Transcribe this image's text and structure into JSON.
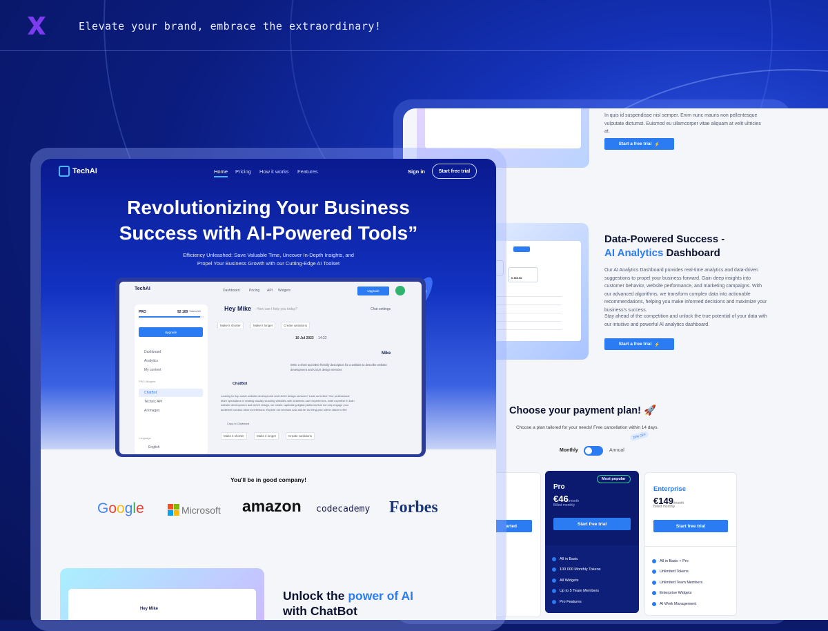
{
  "header": {
    "tagline": "Elevate your brand, embrace the extraordinary!"
  },
  "colors": {
    "accent": "#2b7bf2",
    "brand_x": "#7b3cf0",
    "navy": "#0c1a6b"
  },
  "left": {
    "brand": "TechAI",
    "nav": [
      "Home",
      "Pricing",
      "How it works",
      "Features"
    ],
    "sign_in": "Sign in",
    "start_trial": "Start free trial",
    "hero_title_1": "Revolutionizing Your Business",
    "hero_title_2": "Success with AI-Powered Tools”",
    "hero_sub_1": "Efficiency Unleashed: Save Valuable Time, Uncover In-Depth Insights, and",
    "hero_sub_2": "Propel Your Business Growth with our Cutting-Edge AI Toolset",
    "app": {
      "brand": "TechAI",
      "nav": [
        "Dashboard",
        "Pricing",
        "API",
        "Widgets"
      ],
      "upgrade": "Upgrade",
      "plan": "PRO",
      "tokens": "92 100",
      "tokens_label": "Tokens left",
      "sidebar": [
        "Dashboard",
        "Analytics",
        "My content"
      ],
      "pro_widgets_label": "PRO Widgets",
      "widgets": [
        "ChatBot",
        "Technic API",
        "AI Images"
      ],
      "language_label": "Language",
      "language": "English",
      "greeting": "Hey Mike",
      "greeting_prompt": "- How can I help you today?",
      "chat_settings": "Chat settings",
      "chips": [
        "Make it shorter",
        "Make it longer",
        "Create variations"
      ],
      "date": "10 Jul 2023",
      "time": "14:22",
      "user": "Mike",
      "user_msg": "Write a short and SEO friendly description for a website to describe website development and UI/UX design services",
      "bot": "ChatBot",
      "bot_msg": "Looking for top-notch website development and UI/UX design services? Look no further! Our professional team specializes in crafting visually stunning websites with seamless user experiences. With expertise in both website development and UI/UX design, we create captivating digital platforms that not only engage your audience but also drive conversions. Explore our services now and let us bring your online vision to life!",
      "copy": "Copy to Clipboard"
    },
    "company_title": "You'll be in good company!",
    "brands": [
      "Google",
      "Microsoft",
      "amazon",
      "codecademy",
      "Forbes"
    ],
    "unlock_1": "Unlock the ",
    "unlock_accent": "power of AI",
    "unlock_2": "with ChatBot",
    "mini_greeting": "Hey Mike"
  },
  "right": {
    "top_text": "In quis id suspendisse nisl semper. Enim nunc mauris non pellentesque vulputate dictumst. Euismod eu ullamcorper vitae aliquam at velit ultricies at.",
    "trial": "Start a free trial",
    "data_title_1": "Data-Powered Success -",
    "data_title_accent": "AI Analytics",
    "data_title_2": " Dashboard",
    "data_p1": "Our AI Analytics Dashboard provides real-time analytics and data-driven suggestions to propel your business forward. Gain deep insights into customer behavior, website performance, and marketing campaigns. With our advanced algorithms, we transform complex data into actionable recommendations, helping you make informed decisions and maximize your business's success.",
    "data_p2": "Stay ahead of the competition and unlock the true potential of your data with our intuitive and powerful AI analytics dashboard.",
    "plan_title": "Choose your payment plan!",
    "plan_sub": "Choose a plan tailored for your needs! Free cancellation within 14 days.",
    "monthly": "Monthly",
    "annual": "Annual",
    "discount": "20% OFF",
    "pro": {
      "name": "Pro",
      "badge": "Most popular",
      "price": "€46",
      "per": "/month",
      "billed": "Billed monthly",
      "cta": "Start free trial",
      "features": [
        "All in Basic",
        "100 000 Monthly Tokens",
        "All Widgets",
        "Up to 5 Team Members",
        "Pro Features"
      ]
    },
    "ent": {
      "name": "Enterprise",
      "price": "€149",
      "per": "/month",
      "billed": "Billed monthly",
      "cta": "Start free trial",
      "features": [
        "All in Basic + Pro",
        "Unlimited Tokens",
        "Unlimited Team Members",
        "Enterprise Widgets",
        "AI Work Management"
      ]
    },
    "basic_cta_frag": "arted",
    "basic_feat_frag_1": "okens",
    "basic_feat_frag_2": "ytics",
    "mini_value": "€ 360.5k"
  }
}
